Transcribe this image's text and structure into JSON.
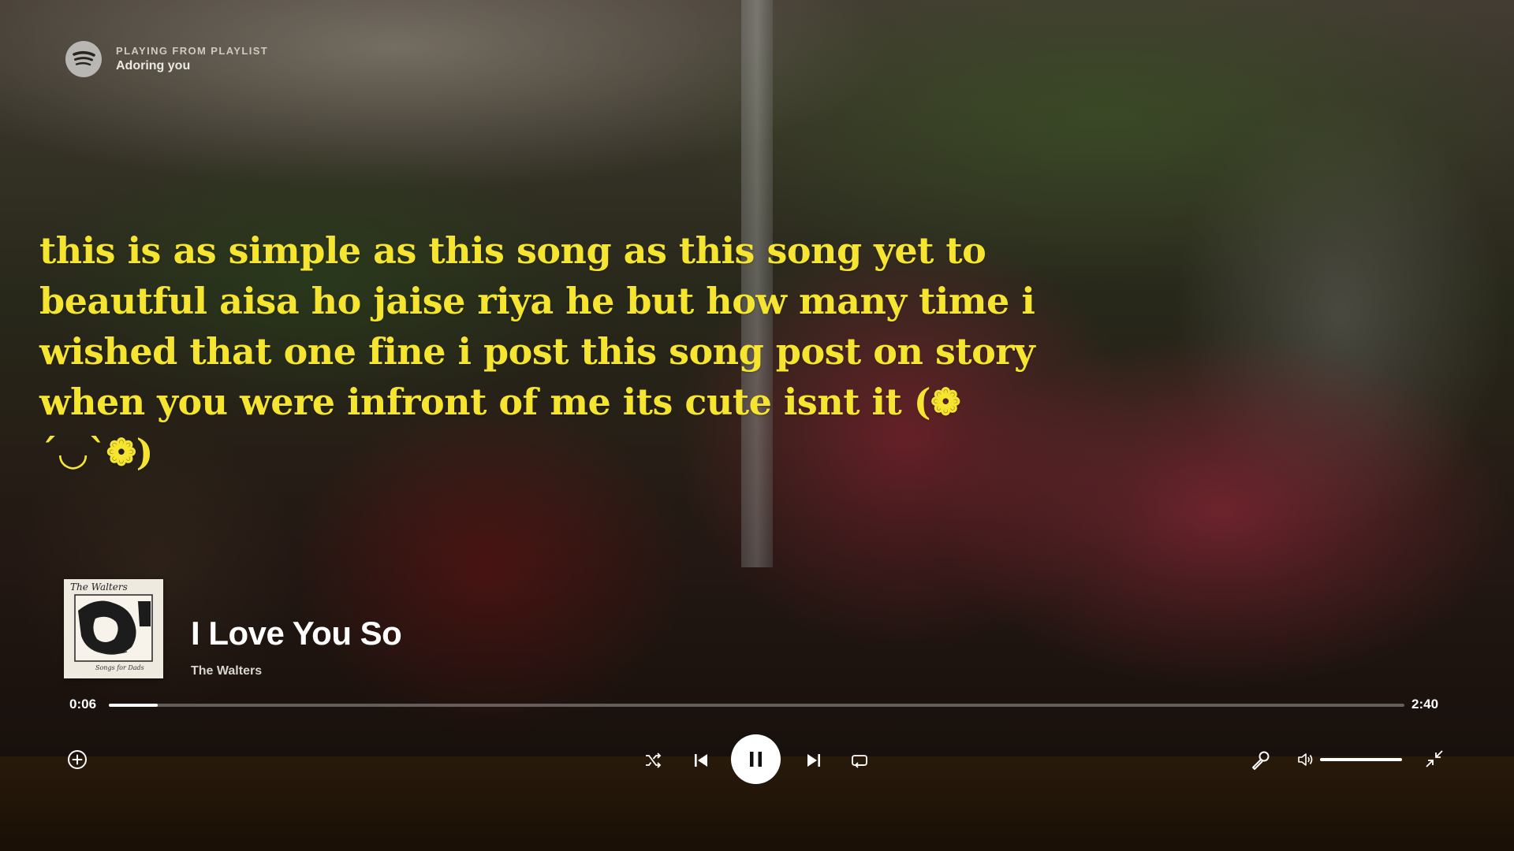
{
  "header": {
    "context_label": "PLAYING FROM PLAYLIST",
    "playlist_name": "Adoring you",
    "logo_icon": "spotify-icon"
  },
  "lyrics": {
    "text": "this is as simple as this song as this song yet to beautful aisa ho jaise riya he but how many time i wished that one fine i post this song post on story when you were infront of me its cute isnt it (❁´◡`❁)",
    "color": "#f5e530"
  },
  "now_playing": {
    "album_art_title": "The Walters",
    "album_art_subtitle": "Songs for Dads",
    "title": "I Love You So",
    "artist": "The Walters"
  },
  "progress": {
    "elapsed": "0:06",
    "total": "2:40",
    "fraction": 0.0375
  },
  "controls": {
    "add_icon": "plus-circle-icon",
    "shuffle_icon": "shuffle-icon",
    "previous_icon": "skip-previous-icon",
    "play_state_icon": "pause-icon",
    "next_icon": "skip-next-icon",
    "repeat_icon": "repeat-icon",
    "lyrics_icon": "microphone-icon",
    "volume_icon": "volume-icon",
    "fullscreen_icon": "exit-fullscreen-icon"
  },
  "volume": {
    "level": 1.0
  }
}
